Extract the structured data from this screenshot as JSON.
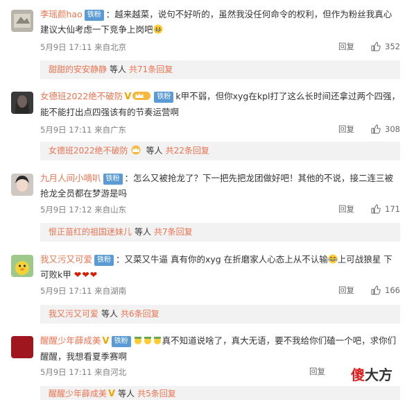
{
  "comments": [
    {
      "username": "李瑶颜hao",
      "badge": "铁粉",
      "text": "：越来越菜，说句不好听的，虽然我没任何命令的权利，但作为粉丝我真心建议大仙考虑一下竞争上岗吧",
      "date": "5月9日 17:11 来自北京",
      "reply_label": "回复",
      "likes": "352",
      "reply_user": "甜甜的安安静静",
      "reply_mid": "等人",
      "reply_link": "共71条回复"
    },
    {
      "username": "女德班2022绝不破防",
      "badge": "铁粉",
      "text": "k甲不弱，但你xyg在kpl打了这么长时间还拿过两个四强，能不能打出点四强该有的节奏运营啊",
      "date": "5月9日 17:11 来自广东",
      "reply_label": "回复",
      "likes": "308",
      "reply_user": "女德班2022绝不破防",
      "reply_mid": "等人",
      "reply_link": "共22条回复"
    },
    {
      "username": "九月人间小嘀叭",
      "badge": "铁粉",
      "text": "：怎么又被抢龙了？下一把先把龙团做好吧！其他的不说，接二连三被抢龙全员都在梦游是吗",
      "date": "5月9日 17:12 来自山东",
      "reply_label": "回复",
      "likes": "171",
      "reply_user": "恨正苗红的祖国迷妹儿",
      "reply_mid": "等人",
      "reply_link": "共7条回复"
    },
    {
      "username": "我又污又可爱",
      "badge": "铁粉",
      "text": "：又菜又牛逼 真有你的xyg 在折磨家人心态上从不认输",
      "text_tail": "上可战狼星 下可败k甲",
      "date": "5月9日 17:11 来自湖南",
      "reply_label": "回复",
      "likes": "166",
      "reply_user": "我又污又可爱",
      "reply_mid": "等人",
      "reply_link": "共6条回复"
    },
    {
      "username": "醒醒少年薛成美",
      "badge": "铁粉",
      "text": "真不知道说啥了，真大无语，要不我给你们磕一个吧，求你们醒醒，我想看夏季赛啊",
      "date": "5月9日 17:11 来自河北",
      "reply_label": "回复",
      "reply_user": "醒醒少年薛成美",
      "reply_mid": "等人",
      "reply_link": "共5条回复"
    }
  ],
  "colors": {
    "accent": "#eb7350",
    "badge": "#5b9bd5",
    "meta": "#808080",
    "reply_bg": "#f2f2f2"
  },
  "watermark": {
    "part1": "傻",
    "part2": "大方"
  }
}
